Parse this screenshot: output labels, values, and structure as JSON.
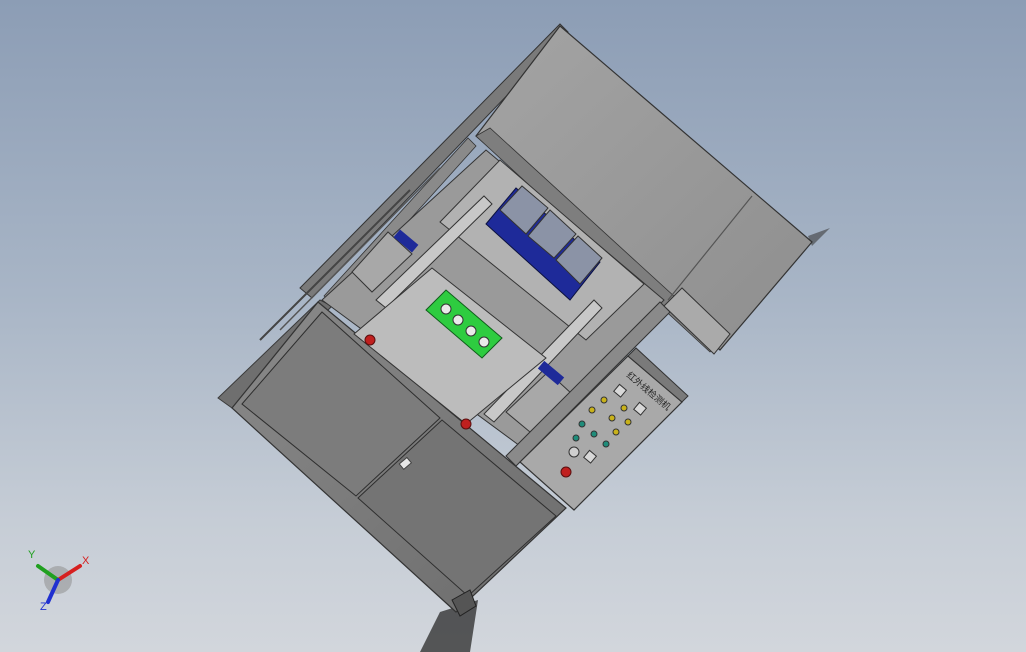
{
  "viewport": {
    "background_top": "#8c9db5",
    "background_bottom": "#d2d6dc"
  },
  "model": {
    "panel_title": "红外线检测机",
    "colors": {
      "frame": "#8e8e8e",
      "frame_dark": "#5a5a5a",
      "panel_light": "#b4b4b4",
      "cabinet": "#7a7a7a",
      "fixture_green": "#2ecc40",
      "cylinder_blue": "#1e2a99",
      "estop_red": "#c0201f",
      "button_yellow": "#c9b21a",
      "button_teal": "#1f8c7a"
    }
  },
  "triad": {
    "x_label": "X",
    "y_label": "Y",
    "z_label": "Z",
    "x_color": "#d62020",
    "y_color": "#20a020",
    "z_color": "#2030d0"
  }
}
